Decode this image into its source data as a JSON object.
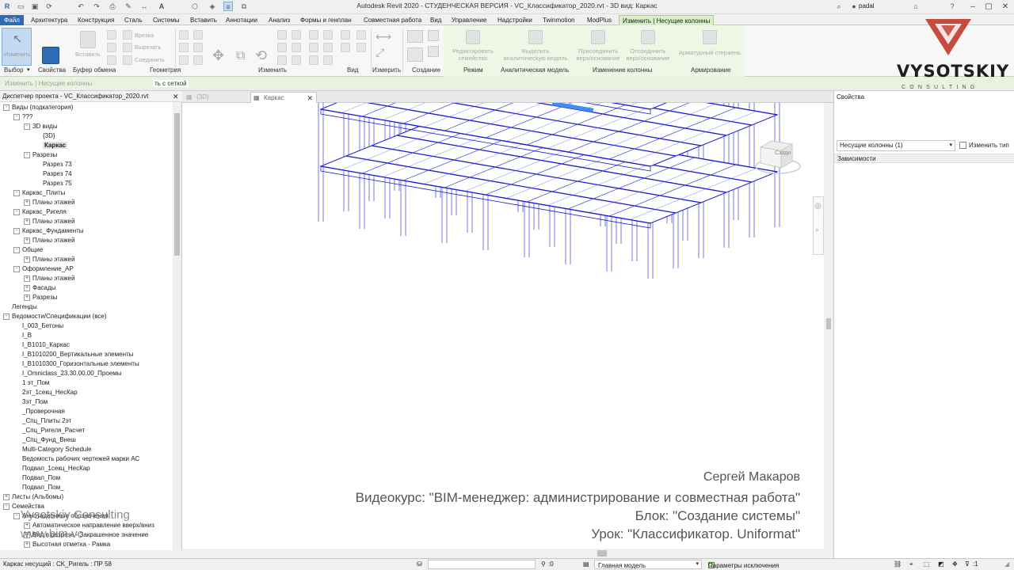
{
  "app": {
    "window_title": "Autodesk Revit 2020 - СТУДЕНЧЕСКАЯ ВЕРСИЯ - VC_Классификатор_2020.rvt - 3D вид: Каркас",
    "user": "padal"
  },
  "menu_tabs": [
    "Файл",
    "Архитектура",
    "Конструкция",
    "Сталь",
    "Системы",
    "Вставить",
    "Аннотации",
    "Анализ",
    "Формы и генплан",
    "Совместная работа",
    "Вид",
    "Управление",
    "Надстройки",
    "Twinmotion",
    "ModPlus",
    "Изменить | Несущие колонны"
  ],
  "ribbon": {
    "buttons": {
      "modify": "Изменить",
      "paste": "Вставить",
      "cut_geometry": "Врезка",
      "join": "Вырезать",
      "connect": "Соединить",
      "edit_family": "Редактировать семейство",
      "highlight_analytical": "Выделить аналитическую модель",
      "attach": "Присоединить верх/основание",
      "detach": "Отсоединить верх/основание",
      "rebar": "Арматурный стержень"
    },
    "panels": [
      "Выбор",
      "Свойства",
      "Буфер обмена",
      "Геометрия",
      "Изменить",
      "Вид",
      "Измерить",
      "Создание",
      "Режим",
      "Аналитическая модель",
      "Изменение колонны",
      "Армирование"
    ]
  },
  "options_bar": {
    "label": "Изменить | Несущие колонны",
    "grid_label": "ть с сеткой"
  },
  "project_browser": {
    "title": "Диспетчер проекта - VC_Классификатор_2020.rvt",
    "items": [
      {
        "label": "Виды (подкатегория)",
        "level": 0,
        "exp": "-"
      },
      {
        "label": "???",
        "level": 1,
        "exp": "-"
      },
      {
        "label": "3D виды",
        "level": 2,
        "exp": "-"
      },
      {
        "label": "{3D}",
        "level": 3,
        "exp": ""
      },
      {
        "label": "Каркас",
        "level": 3,
        "exp": "",
        "selected": true
      },
      {
        "label": "Разрезы",
        "level": 2,
        "exp": "-"
      },
      {
        "label": "Разрез 73",
        "level": 3,
        "exp": ""
      },
      {
        "label": "Разрез 74",
        "level": 3,
        "exp": ""
      },
      {
        "label": "Разрез 75",
        "level": 3,
        "exp": ""
      },
      {
        "label": "Каркас_Плиты",
        "level": 1,
        "exp": "-"
      },
      {
        "label": "Планы этажей",
        "level": 2,
        "exp": "+"
      },
      {
        "label": "Каркас_Ригеля",
        "level": 1,
        "exp": "-"
      },
      {
        "label": "Планы этажей",
        "level": 2,
        "exp": "+"
      },
      {
        "label": "Каркас_Фундаменты",
        "level": 1,
        "exp": "-"
      },
      {
        "label": "Планы этажей",
        "level": 2,
        "exp": "+"
      },
      {
        "label": "Общие",
        "level": 1,
        "exp": "-"
      },
      {
        "label": "Планы этажей",
        "level": 2,
        "exp": "+"
      },
      {
        "label": "Оформление_АР",
        "level": 1,
        "exp": "-"
      },
      {
        "label": "Планы этажей",
        "level": 2,
        "exp": "+"
      },
      {
        "label": "Фасады",
        "level": 2,
        "exp": "+"
      },
      {
        "label": "Разрезы",
        "level": 2,
        "exp": "+"
      },
      {
        "label": "Легенды",
        "level": 0,
        "exp": ""
      },
      {
        "label": "Ведомости/Спецификации (все)",
        "level": 0,
        "exp": "-"
      },
      {
        "label": "I_003_Бетоны",
        "level": 1,
        "exp": ""
      },
      {
        "label": "I_B",
        "level": 1,
        "exp": ""
      },
      {
        "label": "I_B1010_Каркас",
        "level": 1,
        "exp": ""
      },
      {
        "label": "I_B1010200_Вертикальные элементы",
        "level": 1,
        "exp": ""
      },
      {
        "label": "I_B1010300_Горизонтальные элементы",
        "level": 1,
        "exp": ""
      },
      {
        "label": "I_Omniclass_23.30.00.00_Проемы",
        "level": 1,
        "exp": ""
      },
      {
        "label": "1 эт_Пом",
        "level": 1,
        "exp": ""
      },
      {
        "label": "2эт_1секц_НесКар",
        "level": 1,
        "exp": ""
      },
      {
        "label": "3эт_Пом",
        "level": 1,
        "exp": ""
      },
      {
        "label": "_Проверочная",
        "level": 1,
        "exp": ""
      },
      {
        "label": "_Спц_Плиты 2эт",
        "level": 1,
        "exp": ""
      },
      {
        "label": "_Спц_Ригеля_Расчет",
        "level": 1,
        "exp": ""
      },
      {
        "label": "_Спц_Фунд_Внеш",
        "level": 1,
        "exp": ""
      },
      {
        "label": "Multi-Category Schedule",
        "level": 1,
        "exp": ""
      },
      {
        "label": "Ведомость рабочих чертежей марки АС",
        "level": 1,
        "exp": ""
      },
      {
        "label": "Подвал_1секц_НесКар",
        "level": 1,
        "exp": ""
      },
      {
        "label": "Подвал_Пом",
        "level": 1,
        "exp": ""
      },
      {
        "label": "Подвал_Пом_",
        "level": 1,
        "exp": ""
      },
      {
        "label": "Листы (Альбомы)",
        "level": 0,
        "exp": "+"
      },
      {
        "label": "Семейства",
        "level": 0,
        "exp": "-"
      },
      {
        "label": "Аннотационные обозначения",
        "level": 1,
        "exp": "-"
      },
      {
        "label": "Автоматическое направление вверх/вниз",
        "level": 2,
        "exp": "+"
      },
      {
        "label": "Вид в разрезе - Закрашенное значение",
        "level": 2,
        "exp": "+"
      },
      {
        "label": "Высотная отметка - Рамка",
        "level": 2,
        "exp": "+"
      }
    ]
  },
  "view_tabs": [
    "{3D}",
    "Каркас"
  ],
  "properties": {
    "title": "Свойства",
    "type_selector": "Несущие колонны (1)",
    "edit_type": "Изменить тип",
    "category": "Зависимости"
  },
  "viewcube": {
    "face": "Сзади"
  },
  "logo": {
    "brand": "VYSOTSKIY",
    "sub": "CONSULTING",
    "accent": "#c0392b"
  },
  "overlay": {
    "author": "Сергей Макаров",
    "course": "Видеокурс: \"BIM-менеджер: администрирование и совместная работа\"",
    "block": "Блок: \"Создание системы\"",
    "lesson": "Урок: \"Классификатор. Uniformat\""
  },
  "watermark": {
    "line1": "Vysotskiy Consulting",
    "line2": "www.bim.vc"
  },
  "status_bar": {
    "message": "Каркас несущий : CK_Ригель : ПР 58",
    "zero": ":0",
    "model": "Главная модель",
    "exclusions": "Параметры исключения",
    "filter": ":1"
  },
  "colors": {
    "file_tab": "#2d6bb5",
    "context_tab": "#d8f0c8",
    "model_lines": "#1c1ccf",
    "highlight": "#3e8ef7"
  }
}
